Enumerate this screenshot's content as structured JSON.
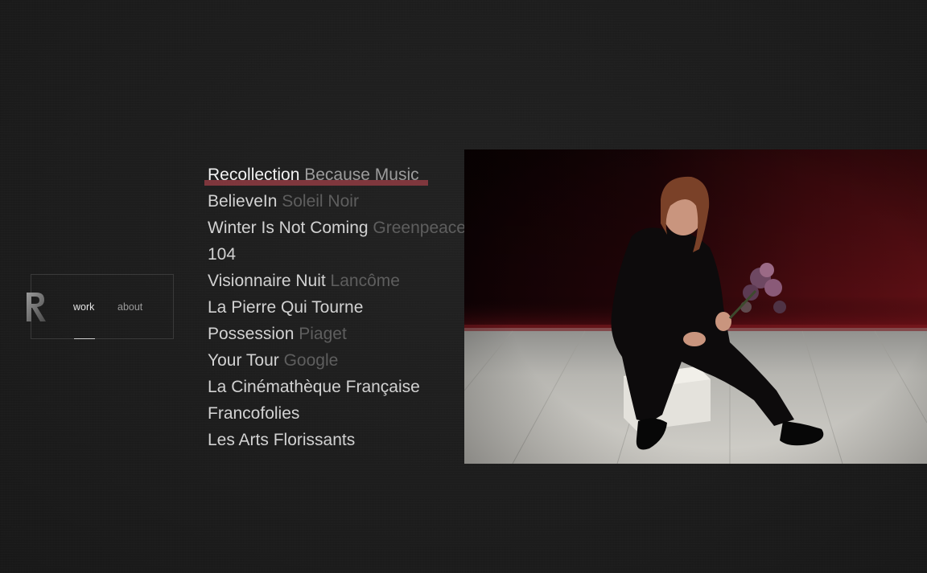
{
  "nav": {
    "logo_icon": "r-monogram-logo",
    "items": [
      {
        "label": "work",
        "active": true
      },
      {
        "label": "about",
        "active": false
      }
    ]
  },
  "projects": [
    {
      "title": "Recollection",
      "client": "Because Music"
    },
    {
      "title": "BelieveIn",
      "client": "Soleil Noir"
    },
    {
      "title": "Winter Is Not Coming",
      "client": "Greenpeace"
    },
    {
      "title": "104",
      "client": ""
    },
    {
      "title": "Visionnaire Nuit",
      "client": "Lancôme"
    },
    {
      "title": "La Pierre Qui Tourne",
      "client": ""
    },
    {
      "title": "Possession",
      "client": "Piaget"
    },
    {
      "title": "Your Tour",
      "client": "Google"
    },
    {
      "title": "La Cinémathèque Française",
      "client": ""
    },
    {
      "title": "Francofolies",
      "client": ""
    },
    {
      "title": "Les Arts Florissants",
      "client": ""
    }
  ],
  "active_project_index": 0,
  "colors": {
    "background": "#1e1e1e",
    "highlight": "#8a3a40",
    "text_active": "#f2f2f2",
    "client_muted": "#5e5e5e"
  }
}
